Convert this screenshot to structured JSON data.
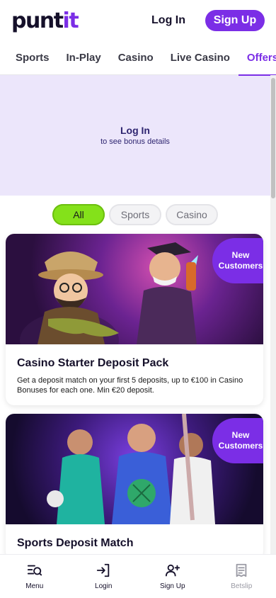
{
  "header": {
    "logo_main": "punt",
    "logo_accent": "it",
    "login_label": "Log In",
    "signup_label": "Sign Up"
  },
  "nav": {
    "tabs": [
      {
        "label": "Sports"
      },
      {
        "label": "In-Play"
      },
      {
        "label": "Casino"
      },
      {
        "label": "Live Casino"
      },
      {
        "label": "Offers"
      }
    ],
    "active": "Offers"
  },
  "login_banner": {
    "title": "Log In",
    "subtitle": "to see bonus details"
  },
  "filters": {
    "all": "All",
    "sports": "Sports",
    "casino": "Casino",
    "selected": "All"
  },
  "offers": [
    {
      "badge_line1": "New",
      "badge_line2": "Customers",
      "title": "Casino Starter Deposit Pack",
      "description": "Get a deposit match on your first 5 deposits, up to €100 in Casino Bonuses for each one. Min €20 deposit."
    },
    {
      "badge_line1": "New",
      "badge_line2": "Customers",
      "title": "Sports Deposit Match",
      "description": ""
    }
  ],
  "bottom_nav": {
    "menu": "Menu",
    "login": "Login",
    "signup": "Sign Up",
    "betslip": "Betslip"
  },
  "colors": {
    "brand": "#7b2ee6",
    "accent_green": "#84e11a",
    "banner_bg": "#ece6fb"
  }
}
